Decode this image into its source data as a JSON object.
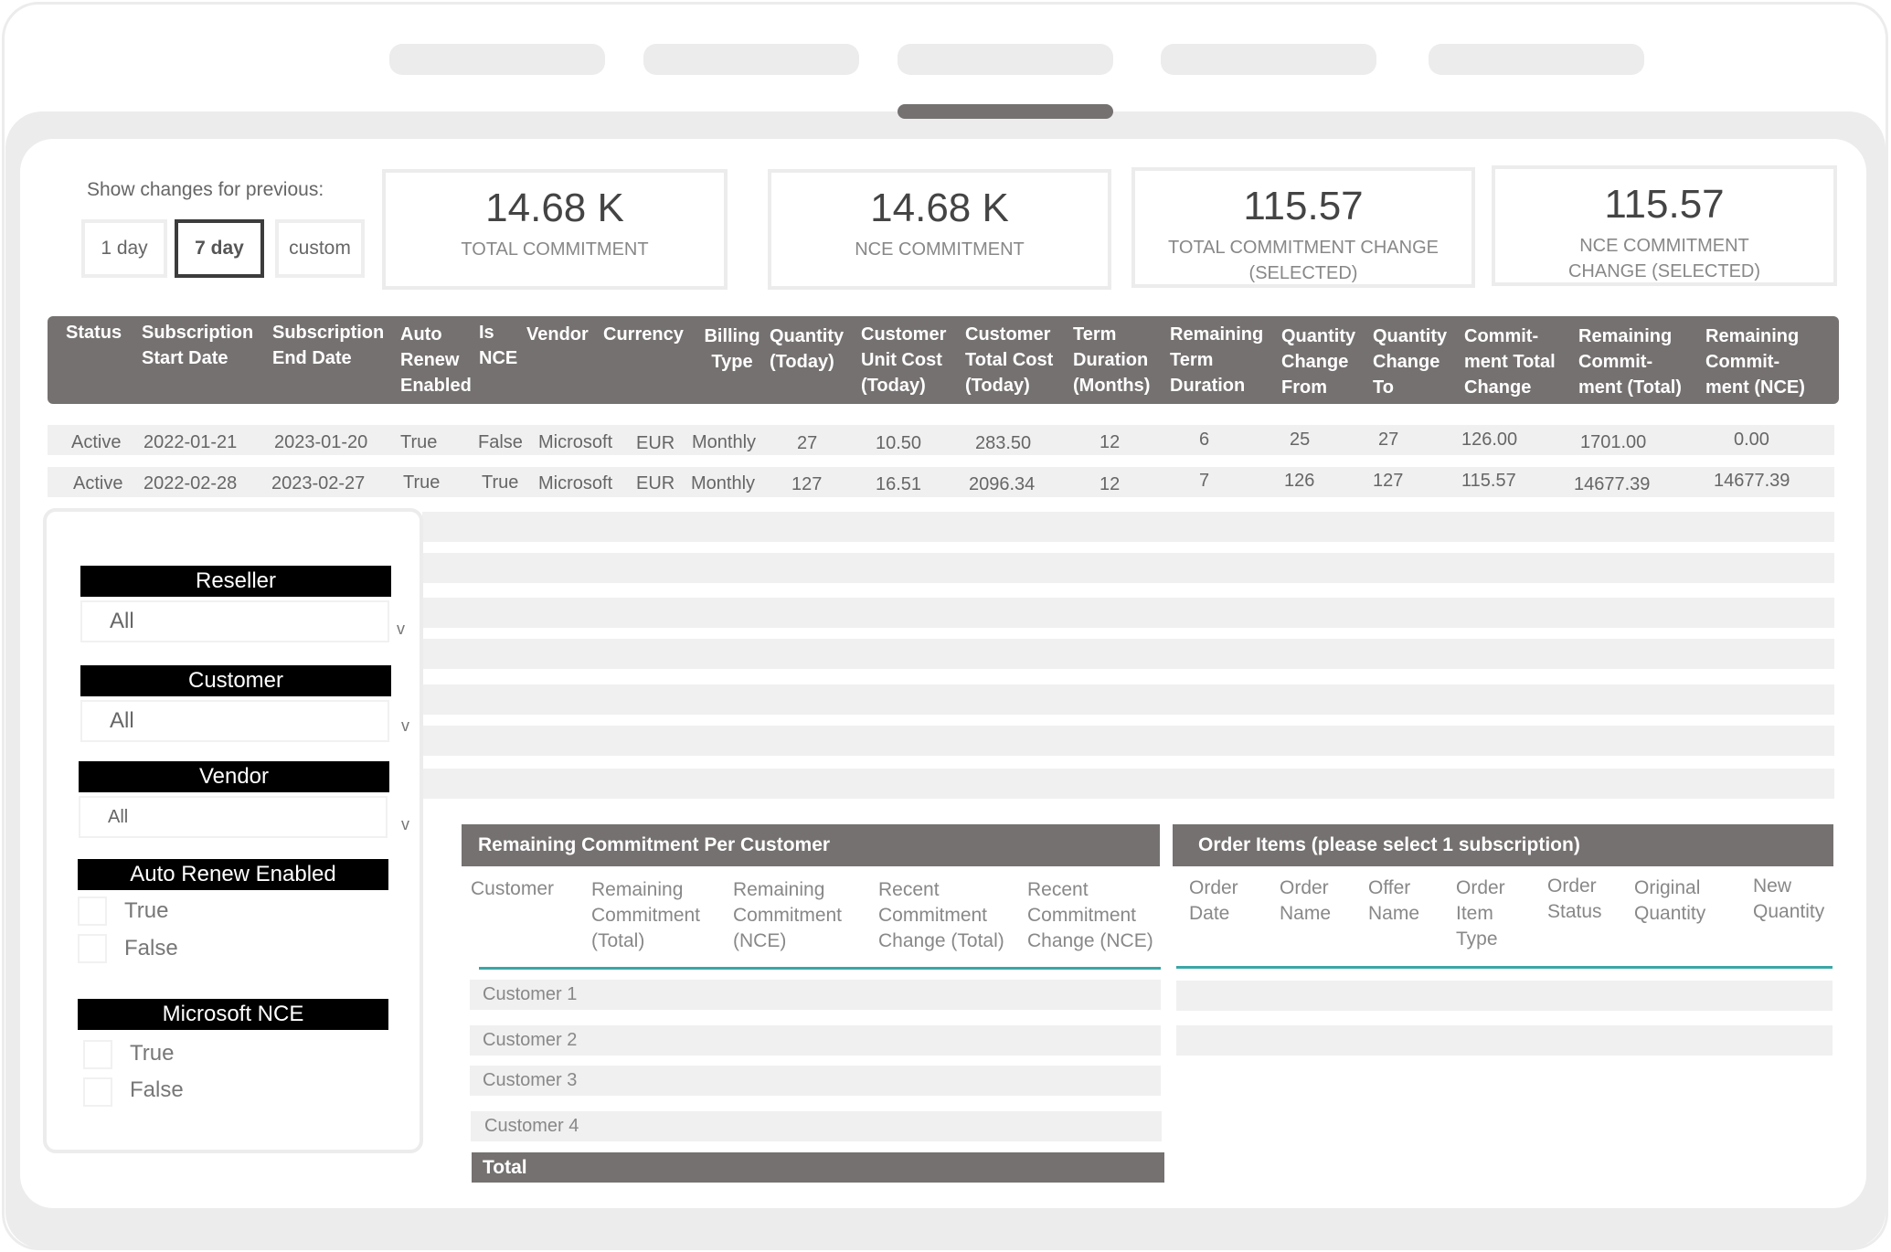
{
  "period": {
    "label": "Show changes for previous:",
    "options": [
      "1 day",
      "7 day",
      "custom"
    ],
    "selected": "7 day"
  },
  "kpis": [
    {
      "value": "14.68 K",
      "label": "TOTAL COMMITMENT"
    },
    {
      "value": "14.68 K",
      "label": "NCE COMMITMENT"
    },
    {
      "value": "115.57",
      "label": "TOTAL COMMITMENT CHANGE (SELECTED)"
    },
    {
      "value": "115.57",
      "label": "NCE COMMITMENT CHANGE (SELECTED)"
    }
  ],
  "subscriptions": {
    "columns": [
      "Status",
      "Subscription Start Date",
      "Subscription End Date",
      "Auto Renew Enabled",
      "Is NCE",
      "Vendor",
      "Currency",
      "Billing Type",
      "Quantity (Today)",
      "Customer Unit Cost (Today)",
      "Customer Total Cost (Today)",
      "Term Duration (Months)",
      "Remaining Term Duration",
      "Quantity Change From",
      "Quantity Change To",
      "Commit- ment Total Change",
      "Remaining Commit- ment (Total)",
      "Remaining Commit- ment (NCE)"
    ],
    "rows": [
      [
        "Active",
        "2022-01-21",
        "2023-01-20",
        "True",
        "False",
        "Microsoft",
        "EUR",
        "Monthly",
        "27",
        "10.50",
        "283.50",
        "12",
        "6",
        "25",
        "27",
        "126.00",
        "1701.00",
        "0.00"
      ],
      [
        "Active",
        "2022-02-28",
        "2023-02-27",
        "True",
        "True",
        "Microsoft",
        "EUR",
        "Monthly",
        "127",
        "16.51",
        "2096.34",
        "12",
        "7",
        "126",
        "127",
        "115.57",
        "14677.39",
        "14677.39"
      ]
    ]
  },
  "filters": {
    "reseller": {
      "title": "Reseller",
      "value": "All"
    },
    "customer": {
      "title": "Customer",
      "value": "All"
    },
    "vendor": {
      "title": "Vendor",
      "value": "All"
    },
    "chevron": "v",
    "auto_renew": {
      "title": "Auto Renew Enabled",
      "options": [
        "True",
        "False"
      ]
    },
    "microsoft_nce": {
      "title": "Microsoft NCE",
      "options": [
        "True",
        "False"
      ]
    }
  },
  "remaining_commitment": {
    "title": "Remaining Commitment Per Customer",
    "columns": [
      "Customer",
      "Remaining Commitment (Total)",
      "Remaining Commitment (NCE)",
      "Recent Commitment Change (Total)",
      "Recent Commitment Change (NCE)"
    ],
    "rows": [
      "Customer 1",
      "Customer 2",
      "Customer 3",
      "Customer 4"
    ],
    "total_label": "Total"
  },
  "order_items": {
    "title": "Order Items (please select 1 subscription)",
    "columns": [
      "Order Date",
      "Order Name",
      "Offer Name",
      "Order Item Type",
      "Order Status",
      "Original Quantity",
      "New Quantity"
    ]
  },
  "colors": {
    "header_gray": "#767171",
    "row_gray": "#f0f0f0",
    "accent_teal": "#3aa6a6",
    "filter_title_black": "#000000"
  }
}
